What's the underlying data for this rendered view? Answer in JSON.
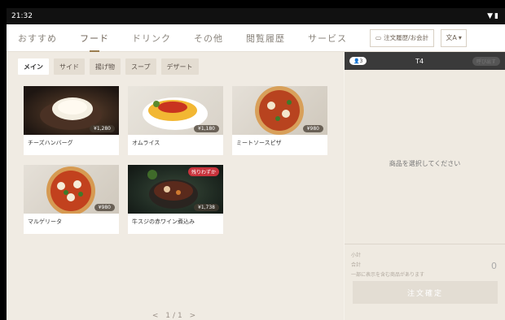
{
  "status": {
    "time": "21:32"
  },
  "nav": {
    "tabs": [
      "おすすめ",
      "フード",
      "ドリンク",
      "その他",
      "閲覧履歴",
      "サービス"
    ],
    "active": 1,
    "order_history_label": "注文履歴/お会計",
    "lang_label": "文A"
  },
  "subtabs": {
    "items": [
      "メイン",
      "サイド",
      "揚げ物",
      "スープ",
      "デザート"
    ],
    "active": 0
  },
  "menu": {
    "items": [
      {
        "name": "チーズハンバーグ",
        "price": "¥1,280"
      },
      {
        "name": "オムライス",
        "price": "¥1,180"
      },
      {
        "name": "ミートソースピザ",
        "price": "¥980"
      },
      {
        "name": "マルゲリータ",
        "price": "¥980"
      },
      {
        "name": "牛スジの赤ワイン煮込み",
        "price": "¥1,738",
        "tag": "残りわずか"
      }
    ]
  },
  "pager": {
    "prev": "<",
    "text": "1/1",
    "next": ">"
  },
  "cart": {
    "guests": "3",
    "table": "T4",
    "help_label": "呼び出す",
    "empty_message": "商品を選択してください",
    "subtotal_label": "小計",
    "total_label": "合計",
    "note": "一部に表示を含む商品があります",
    "total_value": "0",
    "confirm_label": "注文確定"
  }
}
